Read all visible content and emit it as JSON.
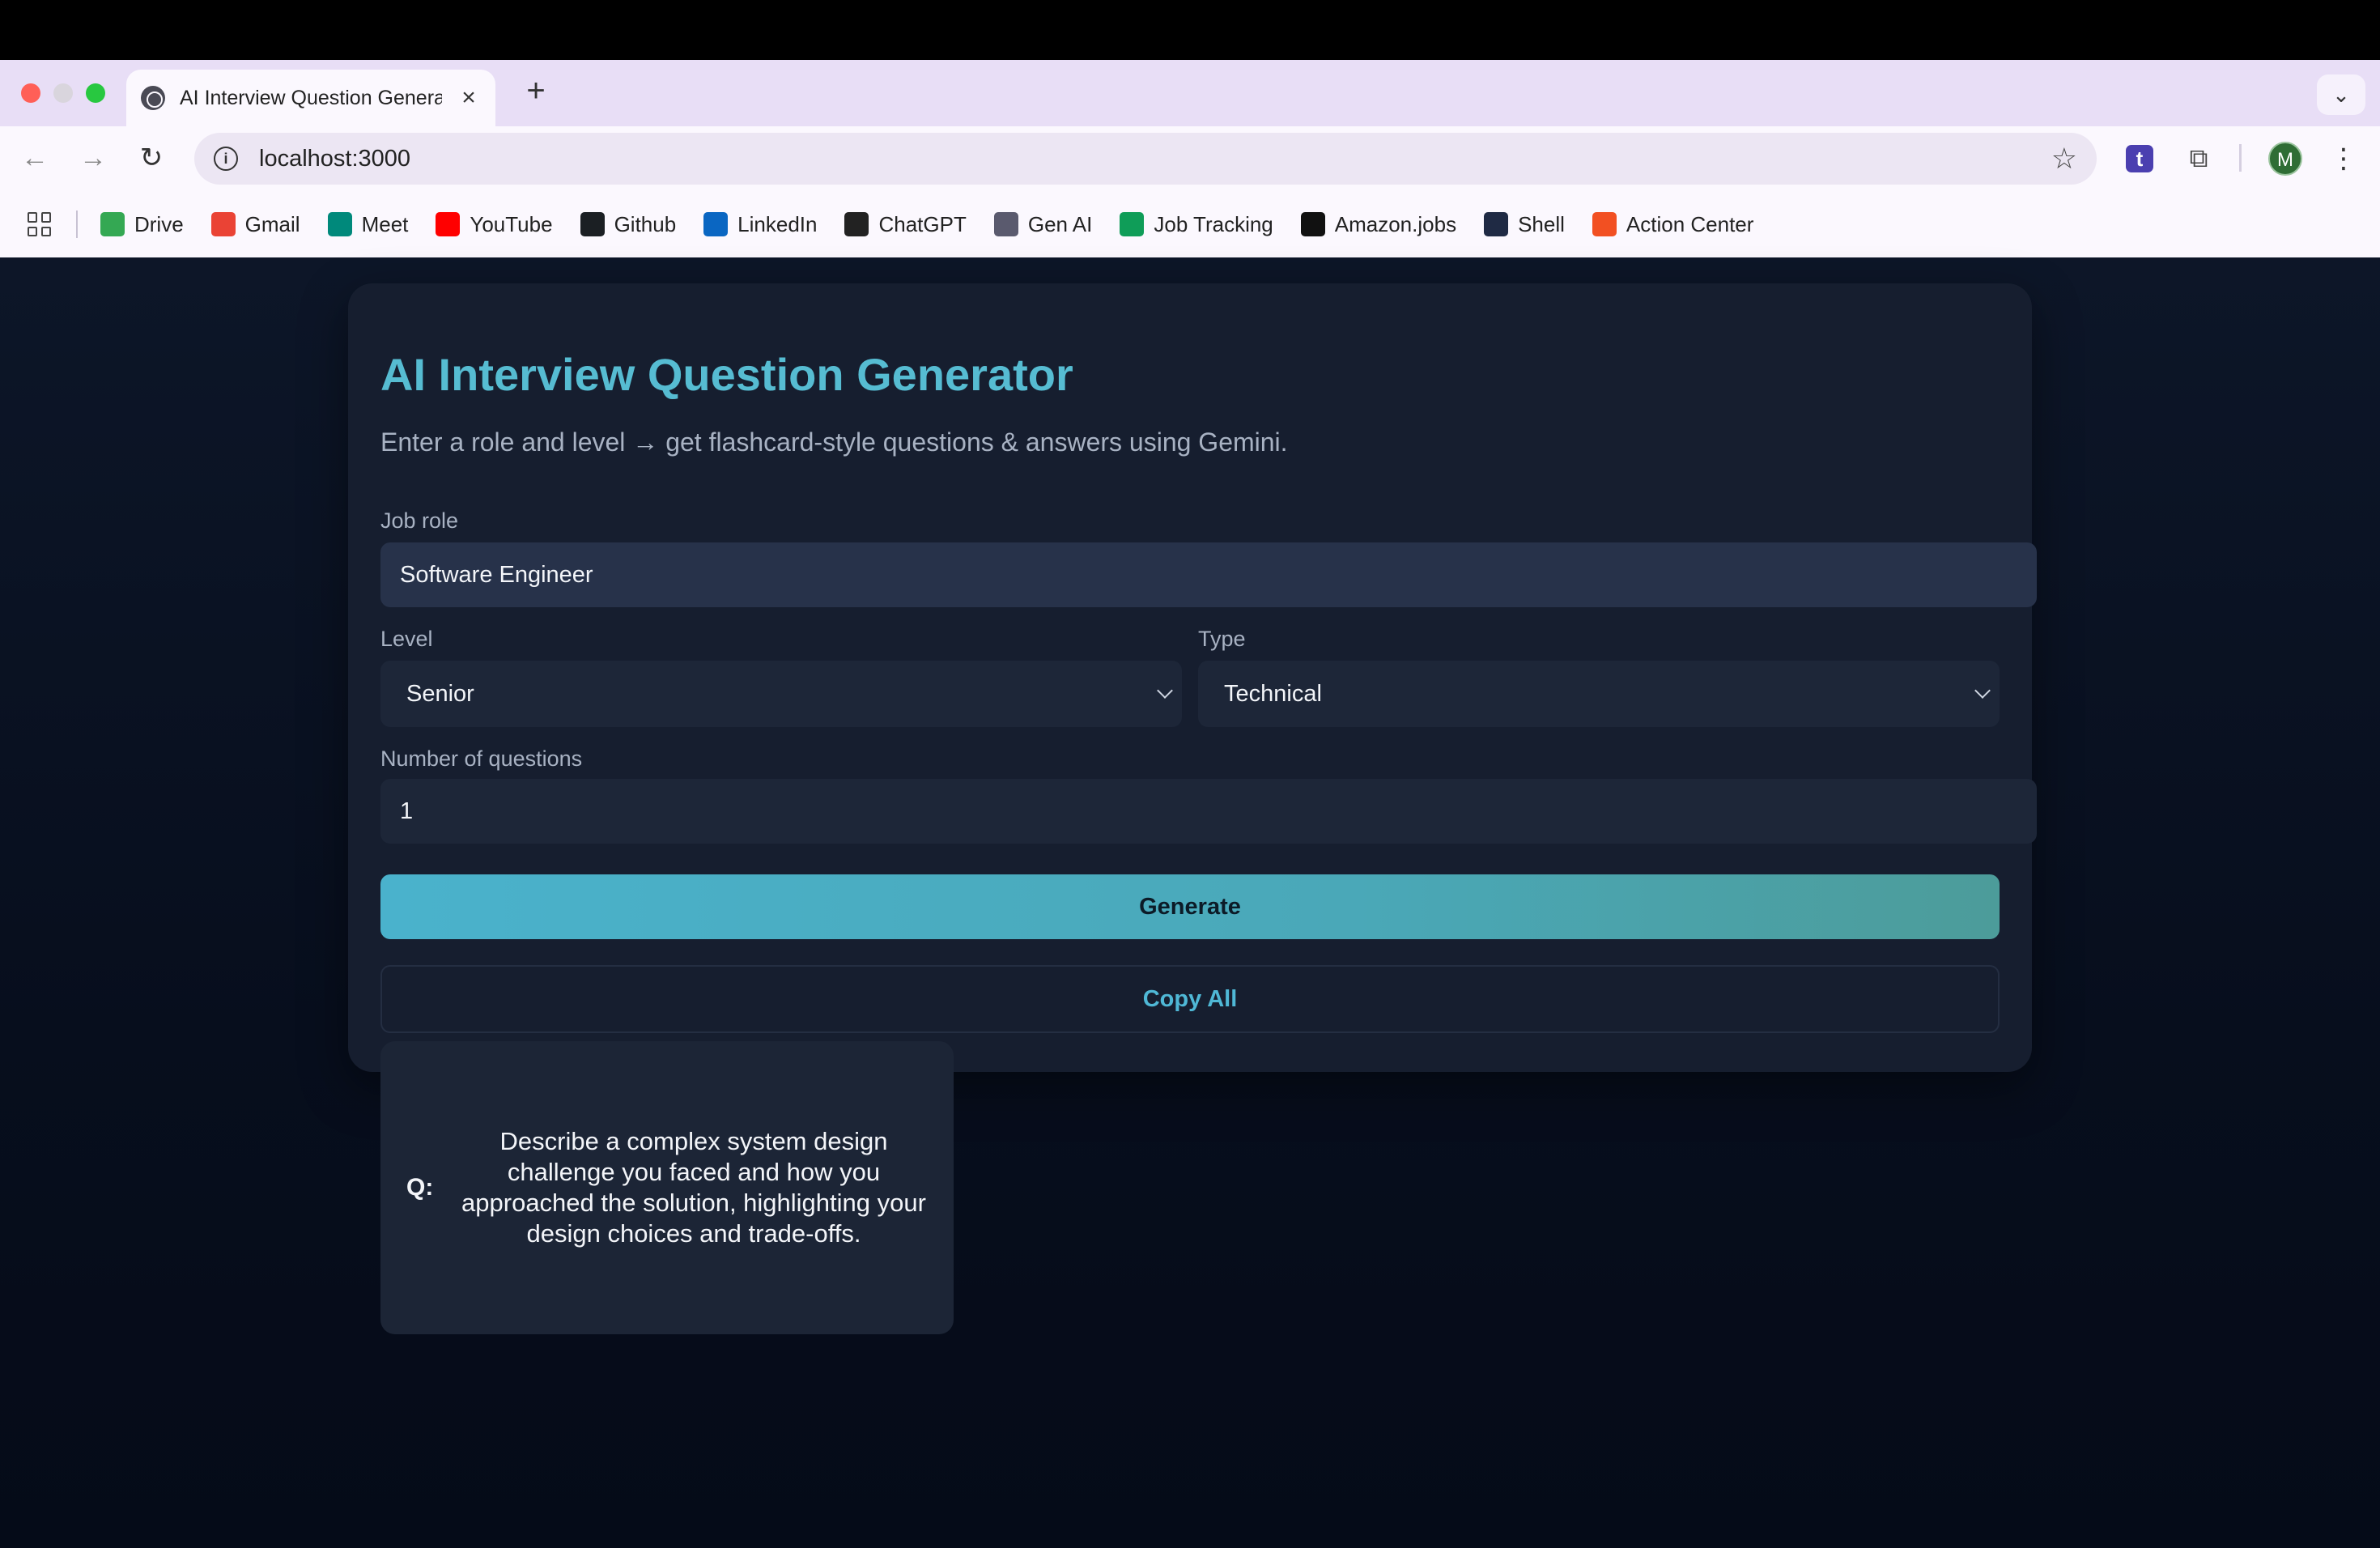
{
  "browser": {
    "tab_title": "AI Interview Question Generator",
    "url": "localhost:3000",
    "avatar_letter": "M",
    "extension_letter": "t",
    "bookmarks": [
      {
        "label": "Drive",
        "icon": "drive-icon",
        "color": "#34a853"
      },
      {
        "label": "Gmail",
        "icon": "gmail-icon",
        "color": "#ea4335"
      },
      {
        "label": "Meet",
        "icon": "meet-icon",
        "color": "#00897b"
      },
      {
        "label": "YouTube",
        "icon": "youtube-icon",
        "color": "#ff0000"
      },
      {
        "label": "Github",
        "icon": "github-icon",
        "color": "#1b1f23"
      },
      {
        "label": "LinkedIn",
        "icon": "linkedin-icon",
        "color": "#0a66c2"
      },
      {
        "label": "ChatGPT",
        "icon": "chatgpt-icon",
        "color": "#222222"
      },
      {
        "label": "Gen AI",
        "icon": "genai-icon",
        "color": "#5a5a6e"
      },
      {
        "label": "Job Tracking",
        "icon": "sheets-icon",
        "color": "#0f9d58"
      },
      {
        "label": "Amazon.jobs",
        "icon": "amazon-icon",
        "color": "#111111"
      },
      {
        "label": "Shell",
        "icon": "shell-icon",
        "color": "#1f2a44"
      },
      {
        "label": "Action Center",
        "icon": "windows-icon",
        "color": "#f25022"
      }
    ]
  },
  "app": {
    "title": "AI Interview Question Generator",
    "subtitle": "Enter a role and level → get flashcard-style questions & answers using Gemini.",
    "job_role_label": "Job role",
    "job_role_value": "Software Engineer",
    "level_label": "Level",
    "level_value": "Senior",
    "type_label": "Type",
    "type_value": "Technical",
    "num_label": "Number of questions",
    "num_value": "1",
    "generate_label": "Generate",
    "copy_all_label": "Copy All",
    "accent_color": "#56bcd2"
  },
  "flashcards": [
    {
      "q_label": "Q:",
      "question": "Describe a complex system design challenge you faced and how you approached the solution, highlighting your design choices and trade-offs."
    }
  ]
}
